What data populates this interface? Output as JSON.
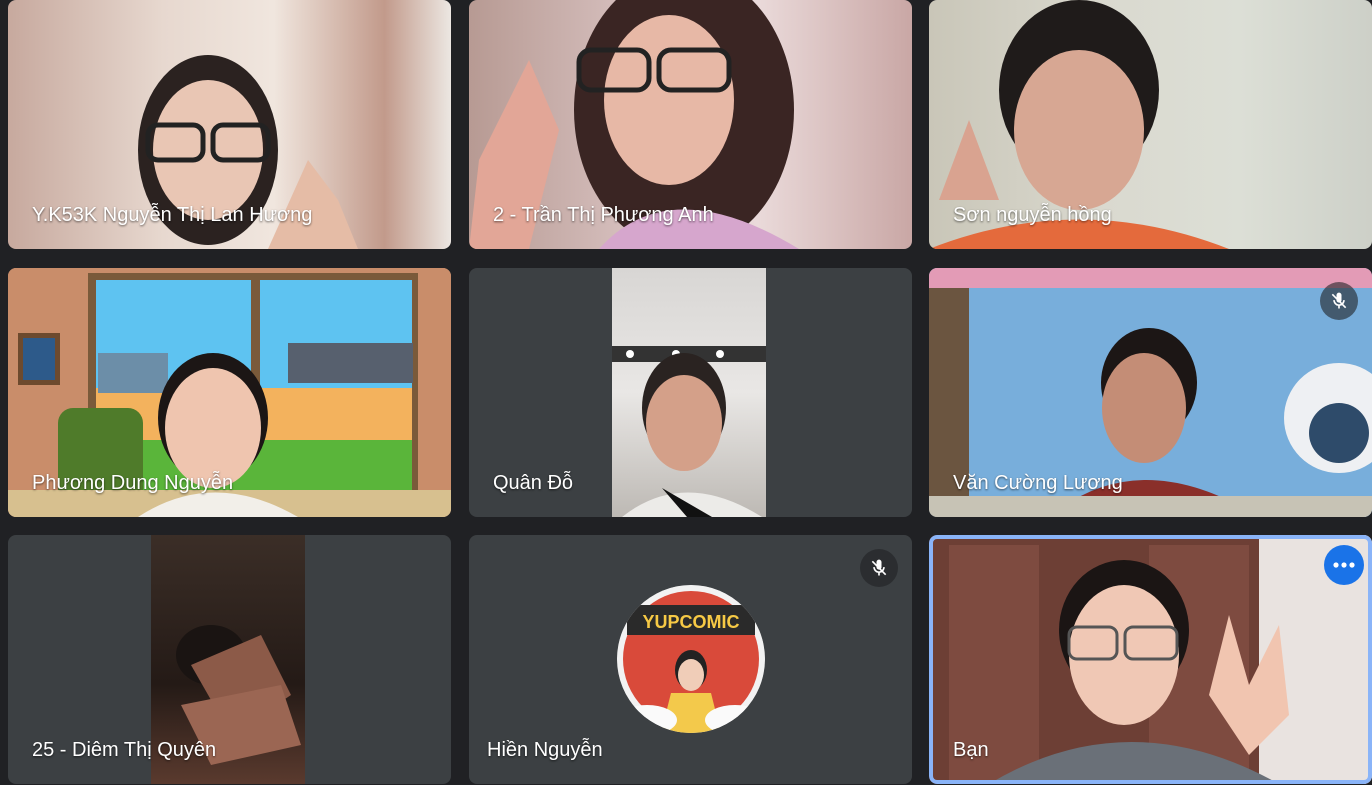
{
  "participants": [
    {
      "name": "Y.K53K Nguyễn Thị Lan Hương"
    },
    {
      "name": "2 - Trần Thị Phương Anh"
    },
    {
      "name": "Sơn nguyễn hồng"
    },
    {
      "name": "Phương Dung Nguyễn"
    },
    {
      "name": "Quân Đỗ"
    },
    {
      "name": "Văn Cường Lương"
    },
    {
      "name": "25 - Diêm Thị Quyên"
    },
    {
      "name": "Hiền Nguyễn"
    },
    {
      "name": "Bạn"
    }
  ],
  "icons": {
    "muted": "mic-off-icon",
    "more": "more-options-icon"
  },
  "colors": {
    "background": "#202124",
    "tile": "#3c4043",
    "self_highlight": "#8ab4f8",
    "more_button": "#1a73e8"
  }
}
